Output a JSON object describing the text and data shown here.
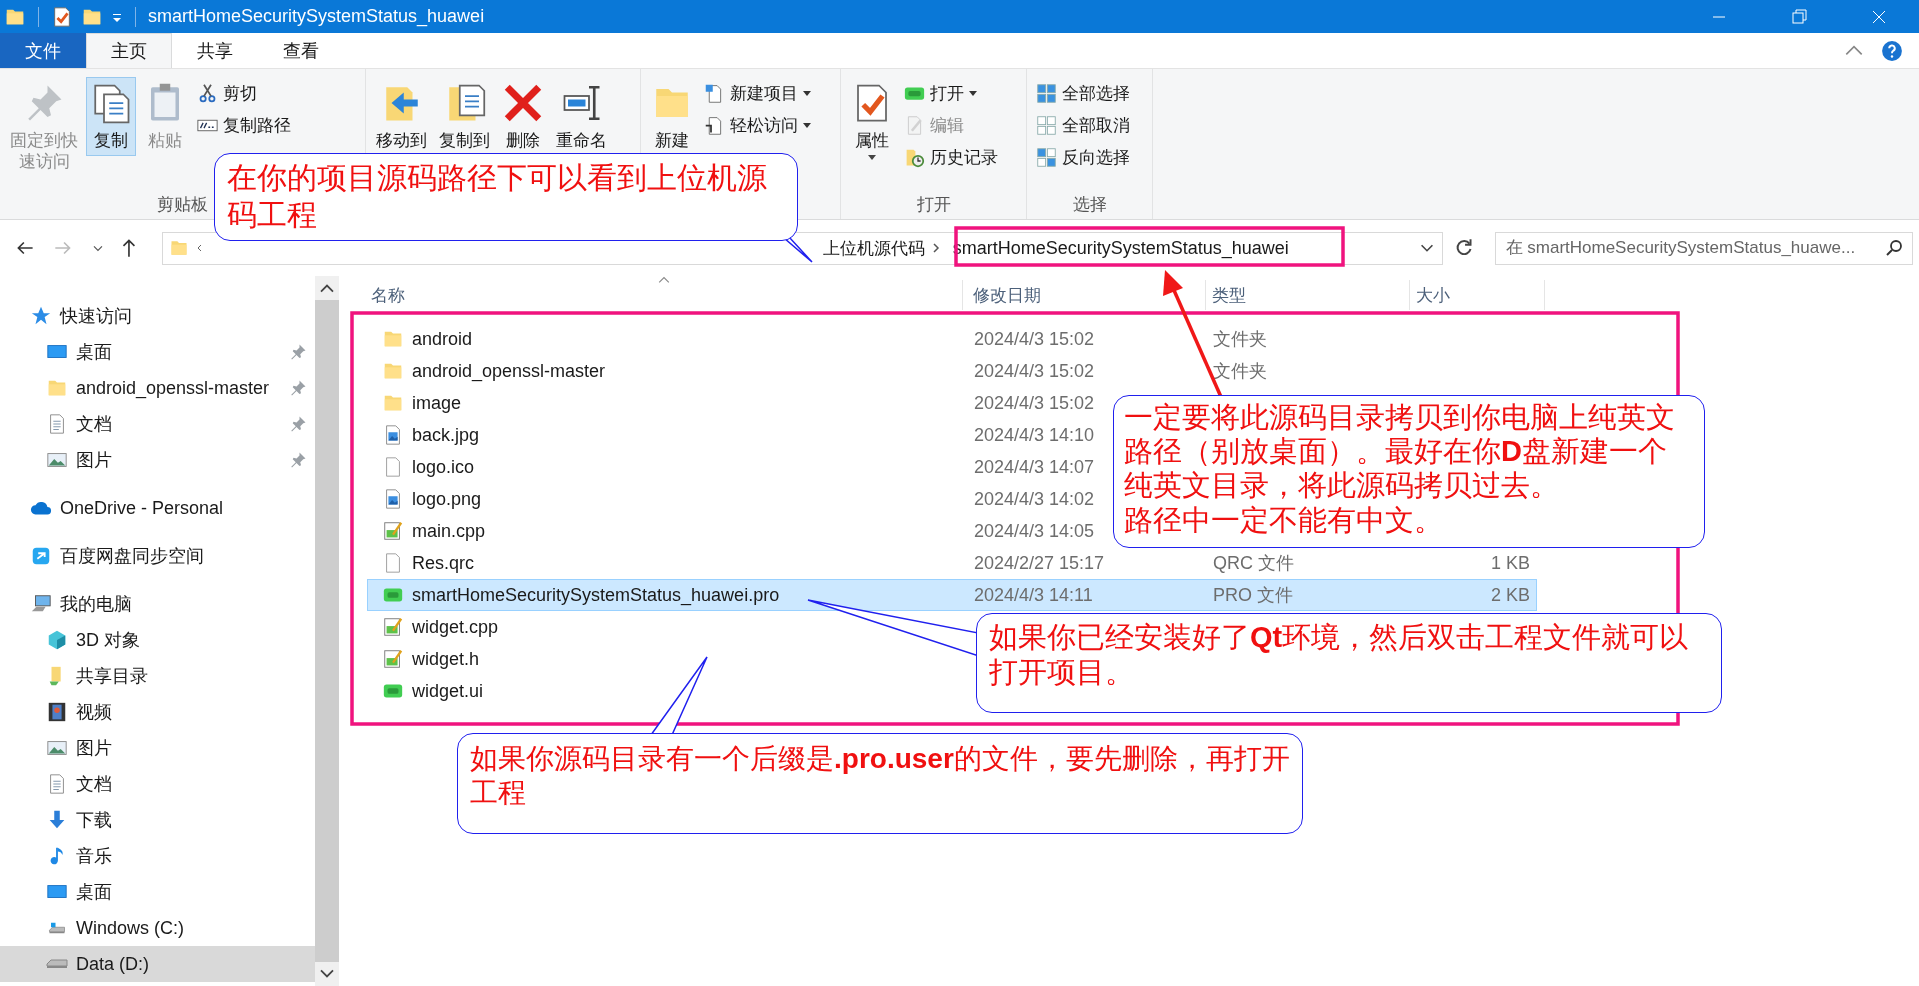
{
  "window": {
    "title": "smartHomeSecuritySystemStatus_huawei"
  },
  "ribbon_tabs": [
    {
      "label": "文件",
      "kind": "menu",
      "selected": false
    },
    {
      "label": "主页",
      "kind": "tab",
      "selected": true
    },
    {
      "label": "共享",
      "kind": "tab",
      "selected": false
    },
    {
      "label": "查看",
      "kind": "tab",
      "selected": false
    }
  ],
  "ribbon": {
    "groups": [
      {
        "label": "剪贴板",
        "large_buttons": [
          {
            "label": "固定到快速访问",
            "kind": "pin",
            "disabled": true,
            "highlighted": false,
            "dropdown": false
          },
          {
            "label": "复制",
            "kind": "copy",
            "disabled": false,
            "highlighted": true,
            "dropdown": false
          },
          {
            "label": "粘贴",
            "kind": "paste",
            "disabled": true,
            "highlighted": false,
            "dropdown": false
          }
        ],
        "small_buttons": [
          {
            "label": "剪切",
            "kind": "cut",
            "disabled": false,
            "dropdown": false
          },
          {
            "label": "复制路径",
            "kind": "copy-path",
            "disabled": false,
            "dropdown": false
          }
        ]
      },
      {
        "large_buttons": [
          {
            "label": "移动到",
            "kind": "move",
            "disabled": false,
            "highlighted": false,
            "dropdown": false
          },
          {
            "label": "复制到",
            "kind": "copy-to",
            "disabled": false,
            "highlighted": false,
            "dropdown": false
          },
          {
            "label": "删除",
            "kind": "delete",
            "disabled": false,
            "highlighted": false,
            "dropdown": false
          },
          {
            "label": "重命名",
            "kind": "rename",
            "disabled": false,
            "highlighted": false,
            "dropdown": false
          }
        ]
      },
      {
        "large_buttons": [
          {
            "label": "新建",
            "kind": "new-folder",
            "disabled": false,
            "highlighted": false,
            "dropdown": false
          }
        ],
        "small_buttons": [
          {
            "label": "新建项目",
            "kind": "new-item",
            "disabled": false,
            "dropdown": true
          },
          {
            "label": "轻松访问",
            "kind": "easy-access",
            "disabled": false,
            "dropdown": true
          }
        ]
      },
      {
        "label": "打开",
        "large_buttons": [
          {
            "label": "属性",
            "kind": "properties",
            "disabled": false,
            "highlighted": false,
            "dropdown": true
          }
        ],
        "small_buttons": [
          {
            "label": "打开",
            "kind": "open",
            "disabled": false,
            "dropdown": true
          },
          {
            "label": "编辑",
            "kind": "edit",
            "disabled": true,
            "dropdown": false
          },
          {
            "label": "历史记录",
            "kind": "history",
            "disabled": false,
            "dropdown": false
          }
        ]
      },
      {
        "label": "选择",
        "small_buttons": [
          {
            "label": "全部选择",
            "kind": "select-all",
            "disabled": false,
            "dropdown": false
          },
          {
            "label": "全部取消",
            "kind": "select-none",
            "disabled": false,
            "dropdown": false
          },
          {
            "label": "反向选择",
            "kind": "invert",
            "disabled": false,
            "dropdown": false
          }
        ]
      }
    ]
  },
  "address_bar": {
    "path": [
      "上位机源代码",
      "smartHomeSecuritySystemStatus_huawei"
    ],
    "search": {
      "placeholder": "在 smartHomeSecuritySystemStatus_huawe..."
    }
  },
  "sidebar": {
    "items": [
      {
        "label": "快速访问",
        "kind": "star",
        "selected": false,
        "children": [
          {
            "label": "桌面",
            "kind": "desktop",
            "pinned": true,
            "selected": false
          },
          {
            "label": "android_openssl-master",
            "kind": "folder",
            "pinned": true,
            "selected": false
          },
          {
            "label": "文档",
            "kind": "document",
            "pinned": true,
            "selected": false
          },
          {
            "label": "图片",
            "kind": "pictures",
            "pinned": true,
            "selected": false
          }
        ]
      },
      {
        "label": "OneDrive - Personal",
        "kind": "cloud",
        "selected": false
      },
      {
        "label": "百度网盘同步空间",
        "kind": "sync",
        "selected": false
      },
      {
        "label": "我的电脑",
        "kind": "computer",
        "selected": false,
        "children": [
          {
            "label": "3D 对象",
            "kind": "cube",
            "selected": false
          },
          {
            "label": "共享目录",
            "kind": "shared",
            "selected": false
          },
          {
            "label": "视频",
            "kind": "video",
            "selected": false
          },
          {
            "label": "图片",
            "kind": "pictures",
            "selected": false
          },
          {
            "label": "文档",
            "kind": "document",
            "selected": false
          },
          {
            "label": "下载",
            "kind": "download",
            "selected": false
          },
          {
            "label": "音乐",
            "kind": "music",
            "selected": false
          },
          {
            "label": "桌面",
            "kind": "desktop",
            "selected": false
          },
          {
            "label": "Windows (C:)",
            "kind": "windows-drive",
            "selected": false
          },
          {
            "label": "Data (D:)",
            "kind": "drive",
            "selected": true
          }
        ]
      }
    ]
  },
  "file_list": {
    "columns": [
      "名称",
      "修改日期",
      "类型",
      "大小"
    ],
    "rows": [
      {
        "name": "android",
        "kind": "folder",
        "date": "2024/4/3 15:02",
        "type": "文件夹",
        "selected": false
      },
      {
        "name": "android_openssl-master",
        "kind": "folder",
        "date": "2024/4/3 15:02",
        "type": "文件夹",
        "selected": false
      },
      {
        "name": "image",
        "kind": "folder",
        "date": "2024/4/3 15:02",
        "selected": false
      },
      {
        "name": "back.jpg",
        "kind": "image",
        "date": "2024/4/3 14:10",
        "selected": false
      },
      {
        "name": "logo.ico",
        "kind": "file",
        "date": "2024/4/3 14:07",
        "selected": false
      },
      {
        "name": "logo.png",
        "kind": "image",
        "date": "2024/4/3 14:02",
        "selected": false
      },
      {
        "name": "main.cpp",
        "kind": "source",
        "date": "2024/4/3 14:05",
        "selected": false
      },
      {
        "name": "Res.qrc",
        "kind": "file",
        "date": "2024/2/27 15:17",
        "type": "QRC 文件",
        "size": "1 KB",
        "selected": false
      },
      {
        "name": "smartHomeSecuritySystemStatus_huawei.pro",
        "kind": "project",
        "date": "2024/4/3 14:11",
        "type": "PRO 文件",
        "size": "2 KB",
        "selected": true
      },
      {
        "name": "widget.cpp",
        "kind": "source",
        "selected": false
      },
      {
        "name": "widget.h",
        "kind": "source",
        "selected": false
      },
      {
        "name": "widget.ui",
        "kind": "project",
        "selected": false
      }
    ]
  },
  "callouts": [
    {
      "paragraphs": [
        "在你的项目源码路径下可以看到上位机源码工程"
      ]
    },
    {
      "paragraphs": [
        "一定要将此源码目录拷贝到你电脑上纯英文路径（别放桌面）。最好在你**D**盘新建一个纯英文目录，将此源码拷贝过去。",
        "路径中一定不能有中文。"
      ]
    },
    {
      "paragraphs": [
        "如果你已经安装好了**Qt**环境，然后双击工程文件就可以打开项目。"
      ]
    },
    {
      "paragraphs": [
        "如果你源码目录有一个后缀是**.pro.user**的文件，要先删除，再打开工程"
      ]
    }
  ]
}
